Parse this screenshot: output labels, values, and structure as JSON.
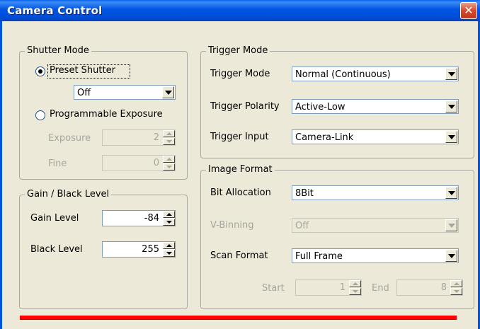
{
  "window": {
    "title": "Camera Control",
    "close_glyph": "✕"
  },
  "shutter": {
    "group_title": "Shutter Mode",
    "preset_label": "Preset Shutter",
    "preset_selected": true,
    "preset_value": "Off",
    "programmable_label": "Programmable Exposure",
    "exposure_label": "Exposure",
    "exposure_value": "2",
    "fine_label": "Fine",
    "fine_value": "0"
  },
  "gain": {
    "group_title": "Gain / Black Level",
    "gain_label": "Gain Level",
    "gain_value": "-84",
    "black_label": "Black Level",
    "black_value": "255"
  },
  "trigger": {
    "group_title": "Trigger Mode",
    "mode_label": "Trigger Mode",
    "mode_value": "Normal (Continuous)",
    "polarity_label": "Trigger Polarity",
    "polarity_value": "Active-Low",
    "input_label": "Trigger Input",
    "input_value": "Camera-Link"
  },
  "image_format": {
    "group_title": "Image Format",
    "bit_label": "Bit Allocation",
    "bit_value": "8Bit",
    "vbin_label": "V-Binning",
    "vbin_value": "Off",
    "scan_label": "Scan Format",
    "scan_value": "Full Frame",
    "start_label": "Start",
    "start_value": "1",
    "end_label": "End",
    "end_value": "8"
  },
  "colors": {
    "title_bar": "#0054E3",
    "status_bar": "#FF0000",
    "face": "#ECE9D8"
  }
}
